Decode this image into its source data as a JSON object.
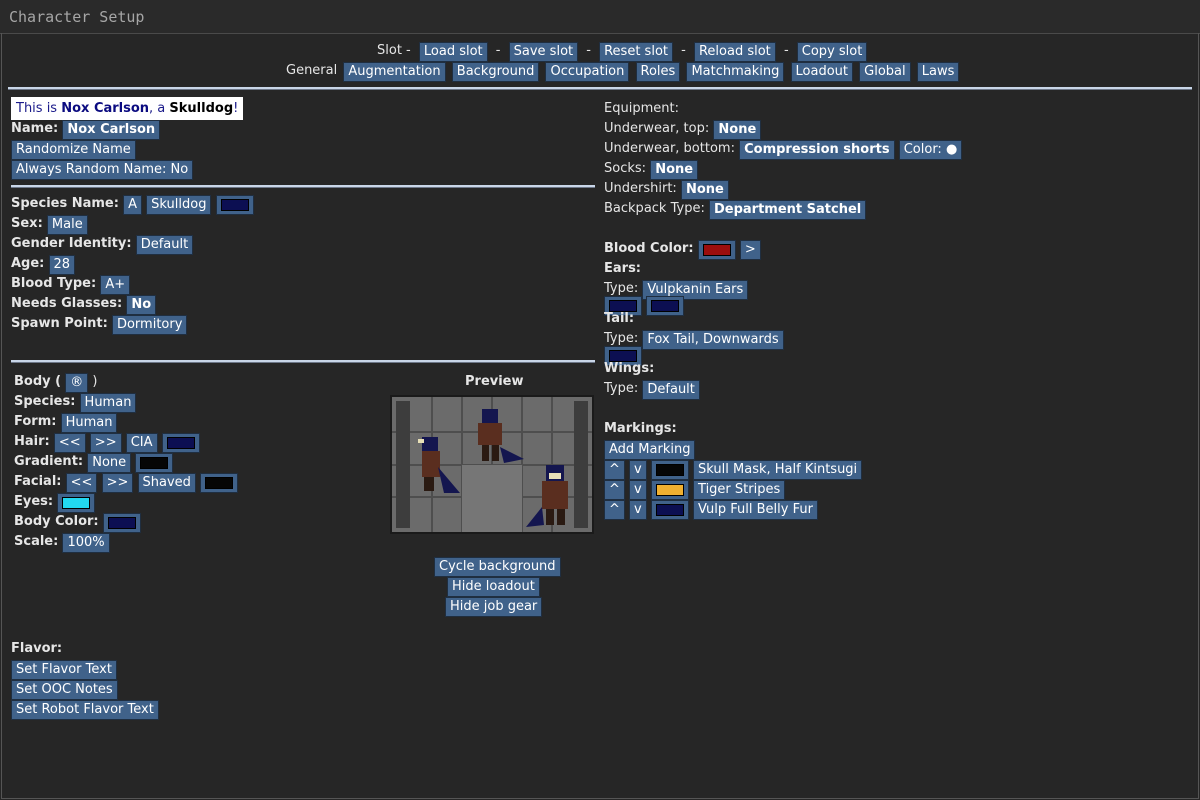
{
  "window": {
    "title": "Character Setup"
  },
  "slot_bar": {
    "label": "Slot -",
    "buttons": [
      "Load slot",
      "Save slot",
      "Reset slot",
      "Reload slot",
      "Copy slot"
    ],
    "sep": "-"
  },
  "tabs": {
    "label": "General",
    "items": [
      "Augmentation",
      "Background",
      "Occupation",
      "Roles",
      "Matchmaking",
      "Loadout",
      "Global",
      "Laws"
    ]
  },
  "identity": {
    "prefix": "This is ",
    "name": "Nox Carlson",
    "mid": ", a ",
    "species": "Skulldog",
    "suffix": "!",
    "name_label": "Name:",
    "name_value": "Nox Carlson",
    "randomize": "Randomize Name",
    "always_random": "Always Random Name: No"
  },
  "general": {
    "species_name_label": "Species Name:",
    "species_name_a": "A",
    "species_name_value": "Skulldog",
    "sex_label": "Sex:",
    "sex_value": "Male",
    "gender_label": "Gender Identity:",
    "gender_value": "Default",
    "age_label": "Age:",
    "age_value": "28",
    "blood_type_label": "Blood Type:",
    "blood_type_value": "A+",
    "glasses_label": "Needs Glasses:",
    "glasses_value": "No",
    "spawn_label": "Spawn Point:",
    "spawn_value": "Dormitory"
  },
  "body": {
    "body_label": "Body (",
    "body_icon": "®",
    "body_close": ")",
    "species_label": "Species:",
    "species_value": "Human",
    "form_label": "Form:",
    "form_value": "Human",
    "hair_label": "Hair:",
    "hair_prev": "<<",
    "hair_next": ">>",
    "hair_value": "CIA",
    "gradient_label": "Gradient:",
    "gradient_value": "None",
    "facial_label": "Facial:",
    "facial_prev": "<<",
    "facial_next": ">>",
    "facial_value": "Shaved",
    "eyes_label": "Eyes:",
    "body_color_label": "Body Color:",
    "scale_label": "Scale:",
    "scale_value": "100%"
  },
  "preview": {
    "title": "Preview",
    "cycle": "Cycle background",
    "hide_loadout": "Hide loadout",
    "hide_gear": "Hide job gear"
  },
  "flavor": {
    "label": "Flavor:",
    "set_flavor": "Set Flavor Text",
    "set_ooc": "Set OOC Notes",
    "set_robot": "Set Robot Flavor Text"
  },
  "equipment": {
    "label": "Equipment:",
    "uw_top_label": "Underwear, top:",
    "uw_top_value": "None",
    "uw_bottom_label": "Underwear, bottom:",
    "uw_bottom_value": "Compression shorts",
    "color_label": "Color:",
    "color_dot": "●",
    "socks_label": "Socks:",
    "socks_value": "None",
    "undershirt_label": "Undershirt:",
    "undershirt_value": "None",
    "backpack_label": "Backpack Type:",
    "backpack_value": "Department Satchel"
  },
  "features": {
    "blood_color_label": "Blood Color:",
    "blood_next": ">",
    "ears_label": "Ears:",
    "type_label": "Type:",
    "ears_type": "Vulpkanin Ears",
    "tail_label": "Tail:",
    "tail_type": "Fox Tail, Downwards",
    "wings_label": "Wings:",
    "wings_type": "Default"
  },
  "markings": {
    "label": "Markings:",
    "add": "Add Marking",
    "up": "^",
    "down": "v",
    "items": [
      "Skull Mask, Half Kintsugi",
      "Tiger Stripes",
      "Vulp Full Belly Fur"
    ]
  },
  "colors": {
    "button": "#40628a",
    "navy": "#0c0f52",
    "black": "#060606",
    "cyan": "#22d8f0",
    "orange": "#f0b030",
    "blood": "#9b0d0d",
    "hr": "#c9d6e8"
  }
}
